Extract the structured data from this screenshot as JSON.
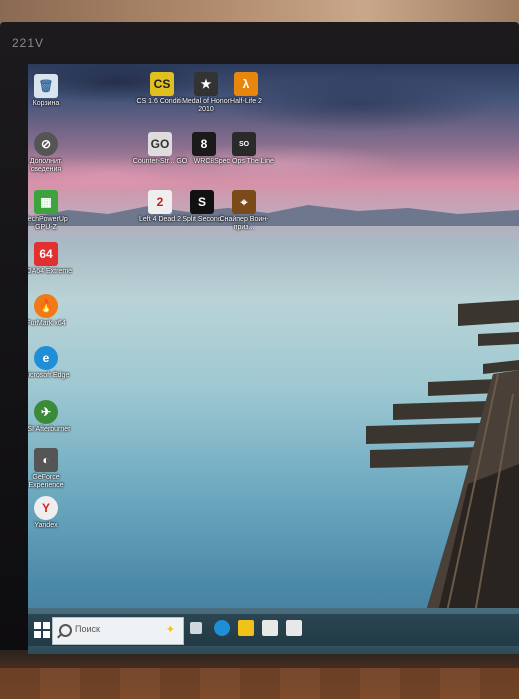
{
  "monitor": {
    "brand": "221V"
  },
  "desktop": {
    "icons": [
      {
        "id": "recycle-bin",
        "label": "Корзина",
        "icon": "recycle-bin-icon",
        "color": "#d8e4ee"
      },
      {
        "id": "extra-info",
        "label": "Дополнит. сведения",
        "icon": "info-icon",
        "color": "#555555"
      },
      {
        "id": "gpu-z",
        "label": "TechPowerUp GPU-Z",
        "icon": "gpu-z-icon",
        "color": "#3da33d"
      },
      {
        "id": "aida64",
        "label": "AIDA64 Extreme",
        "icon": "aida64-icon",
        "color": "#e03030"
      },
      {
        "id": "furmark",
        "label": "FurMark x64",
        "icon": "furmark-icon",
        "color": "#f07a18"
      },
      {
        "id": "edge",
        "label": "Microsoft Edge",
        "icon": "edge-icon",
        "color": "#1e8fd6"
      },
      {
        "id": "afterburner",
        "label": "MSI Afterburner",
        "icon": "afterburner-icon",
        "color": "#3a8a3a"
      },
      {
        "id": "geforce",
        "label": "GeForce Experience",
        "icon": "nvidia-icon",
        "color": "#555555"
      },
      {
        "id": "yandex",
        "label": "Yandex",
        "icon": "yandex-icon",
        "color": "#e8e8e8"
      },
      {
        "id": "cs16",
        "label": "CS 1.6 Conditi...",
        "icon": "cs16-icon",
        "color": "#e0c020"
      },
      {
        "id": "moh",
        "label": "Medal of Honor 2010",
        "icon": "moh-icon",
        "color": "#333333"
      },
      {
        "id": "hl2",
        "label": "Half-Life 2",
        "icon": "hl2-icon",
        "color": "#e8870e"
      },
      {
        "id": "csgo",
        "label": "Counter-Str... GO",
        "icon": "csgo-icon",
        "color": "#dddddd"
      },
      {
        "id": "wrc8",
        "label": "WRC8",
        "icon": "wrc8-icon",
        "color": "#1a1a1a"
      },
      {
        "id": "specops",
        "label": "Spec Ops The Line",
        "icon": "specops-icon",
        "color": "#2a2a2a"
      },
      {
        "id": "l4d2",
        "label": "Left 4 Dead 2",
        "icon": "l4d2-icon",
        "color": "#eeeeee"
      },
      {
        "id": "splitsecond",
        "label": "Split Second",
        "icon": "splitsecond-icon",
        "color": "#111111"
      },
      {
        "id": "sniper",
        "label": "Снайпер Воин-приз...",
        "icon": "sniper-icon",
        "color": "#7a4a1a"
      }
    ]
  },
  "taskbar": {
    "search_placeholder": "Поиск",
    "apps": [
      {
        "name": "task-view-icon",
        "color": "#cfd8dc"
      },
      {
        "name": "edge-icon",
        "color": "#1e8fd6"
      },
      {
        "name": "file-explorer-icon",
        "color": "#f2c21b"
      },
      {
        "name": "store-icon",
        "color": "#e8e8e8"
      },
      {
        "name": "mail-icon",
        "color": "#e8e8e8"
      }
    ]
  }
}
